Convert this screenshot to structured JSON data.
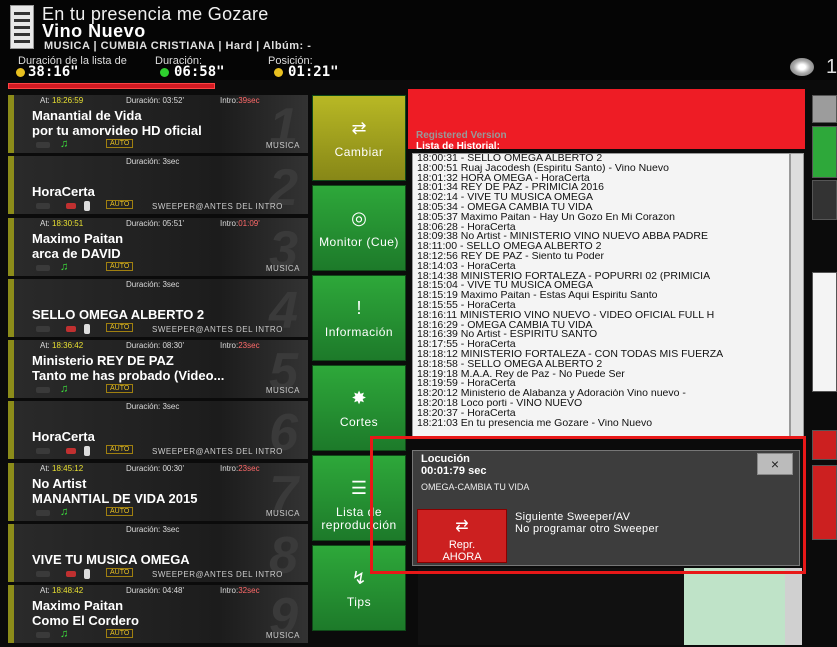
{
  "now_playing": {
    "artist": "En tu presencia me Gozare",
    "title": "Vino Nuevo",
    "meta": "MUSICA | CUMBIA CRISTIANA | Hard | Albúm: -"
  },
  "timers": {
    "list_duration_label": "Duración de la lista de",
    "list_duration_value": "38:16\"",
    "duration_label": "Duración:",
    "duration_value": "06:58\"",
    "position_label": "Posición:",
    "position_value": "01:21\""
  },
  "queue": [
    {
      "at_label": "At:",
      "at": "18:26:59",
      "dur_label": "Duración:",
      "dur": "03:52'",
      "intro_label": "Intro:",
      "intro": "39sec",
      "line1": "Manantial de Vida",
      "line2": "por tu amorvideo HD oficial",
      "auto": "AUTO",
      "category": "MUSICA",
      "num": "1"
    },
    {
      "at_label": "",
      "at": "",
      "dur_label": "Duración:",
      "dur": "3sec",
      "intro_label": "",
      "intro": "",
      "line1": "",
      "line2": "HoraCerta",
      "auto": "AUTO",
      "category": "SWEEPER@ANTES DEL INTRO",
      "num": "2"
    },
    {
      "at_label": "At:",
      "at": "18:30:51",
      "dur_label": "Duración:",
      "dur": "05:51'",
      "intro_label": "Intro:",
      "intro": "01:09'",
      "line1": "Maximo Paitan",
      "line2": "arca de DAVID",
      "auto": "AUTO",
      "category": "MUSICA",
      "num": "3"
    },
    {
      "at_label": "",
      "at": "",
      "dur_label": "Duración:",
      "dur": "3sec",
      "intro_label": "",
      "intro": "",
      "line1": "",
      "line2": "SELLO OMEGA ALBERTO 2",
      "auto": "AUTO",
      "category": "SWEEPER@ANTES DEL INTRO",
      "num": "4"
    },
    {
      "at_label": "At:",
      "at": "18:36:42",
      "dur_label": "Duración:",
      "dur": "08:30'",
      "intro_label": "Intro:",
      "intro": "23sec",
      "line1": "Ministerio REY DE PAZ",
      "line2": "Tanto me has probado (Video...",
      "auto": "AUTO",
      "category": "MUSICA",
      "num": "5"
    },
    {
      "at_label": "",
      "at": "",
      "dur_label": "Duración:",
      "dur": "3sec",
      "intro_label": "",
      "intro": "",
      "line1": "",
      "line2": "HoraCerta",
      "auto": "AUTO",
      "category": "SWEEPER@ANTES DEL INTRO",
      "num": "6"
    },
    {
      "at_label": "At:",
      "at": "18:45:12",
      "dur_label": "Duración:",
      "dur": "00:30'",
      "intro_label": "Intro:",
      "intro": "23sec",
      "line1": "No Artist",
      "line2": "MANANTIAL DE VIDA 2015",
      "auto": "AUTO",
      "category": "MUSICA",
      "num": "7"
    },
    {
      "at_label": "",
      "at": "",
      "dur_label": "Duración:",
      "dur": "3sec",
      "intro_label": "",
      "intro": "",
      "line1": "",
      "line2": "VIVE TU MUSICA OMEGA",
      "auto": "AUTO",
      "category": "SWEEPER@ANTES DEL INTRO",
      "num": "8"
    },
    {
      "at_label": "At:",
      "at": "18:48:42",
      "dur_label": "Duración:",
      "dur": "04:48'",
      "intro_label": "Intro:",
      "intro": "32sec",
      "line1": "Maximo Paitan",
      "line2": "Como El Cordero",
      "auto": "AUTO",
      "category": "MUSICA",
      "num": "9"
    }
  ],
  "buttons": [
    {
      "label": "Cambiar",
      "icon": "⇄"
    },
    {
      "label": "Monitor (Cue)",
      "icon": "◎"
    },
    {
      "label": "Información",
      "icon": "!"
    },
    {
      "label": "Cortes",
      "icon": "✸"
    },
    {
      "label": "Lista de reproducción",
      "icon": "☰"
    },
    {
      "label": "Tips",
      "icon": "↯"
    }
  ],
  "registered": "Registered Version",
  "history_label": "Lista de Historial:",
  "history": [
    "18:00:31 - SELLO OMEGA ALBERTO 2",
    "18:00:51 Ruaj Jacodesh (Espiritu Santo) - Vino Nuevo",
    "18:01:32 HORA OMEGA - HoraCerta",
    "18:01:34 REY DE PAZ - PRIMICIA 2016",
    "18:02:14 - VIVE TU MUSICA OMEGA",
    "18:05:34 - OMEGA CAMBIA TU VIDA",
    "18:05:37 Maximo Paitan - Hay Un Gozo En Mi Corazon",
    "18:06:28 - HoraCerta",
    "18:09:38 No Artist - MINISTERIO VINO NUEVO ABBA PADRE",
    "18:11:00 - SELLO OMEGA ALBERTO 2",
    "18:12:56 REY DE PAZ - Siento tu Poder",
    "18:14:03 - HoraCerta",
    "18:14:38 MINISTERIO FORTALEZA - POPURRI 02 (PRIMICIA",
    "18:15:04 - VIVE TU MUSICA OMEGA",
    "18:15:19 Maximo Paitan - Estas Aqui Espiritu Santo",
    "18:15:55 - HoraCerta",
    "18:16:11 MINISTERIO VINO NUEVO - VIDEO OFICIAL FULL H",
    "18:16:29 - OMEGA CAMBIA TU VIDA",
    "18:16:39 No Artist - ESPIRITU SANTO",
    "18:17:55 - HoraCerta",
    "18:18:12 MINISTERIO FORTALEZA - CON TODAS MIS FUERZA",
    "18:18:58 - SELLO OMEGA ALBERTO 2",
    "18:19:18 M.A.A. Rey de Paz - No Puede Ser",
    "18:19:59 - HoraCerta",
    "18:20:12 Ministerio de Alabanza y Adoración Vino nuevo -",
    "18:20:18 Loco porti - VINO NUEVO",
    "18:20:37 - HoraCerta",
    "18:21:03 En tu presencia me Gozare - Vino Nuevo"
  ],
  "locucion": {
    "title": "Locución",
    "time": "00:01:79 sec",
    "track": "OMEGA-CAMBIA TU VIDA",
    "close": "×",
    "btn_line1": "Repr.",
    "btn_line2": "AHORA",
    "btn_icon": "⇄",
    "next_line1": "Siguiente Sweeper/AV",
    "next_line2": "No programar otro Sweeper"
  },
  "side_digit": "1",
  "colors": {
    "accent_green": "#2ea83a",
    "accent_red": "#ee1c25",
    "highlight_box": "#e81818"
  }
}
